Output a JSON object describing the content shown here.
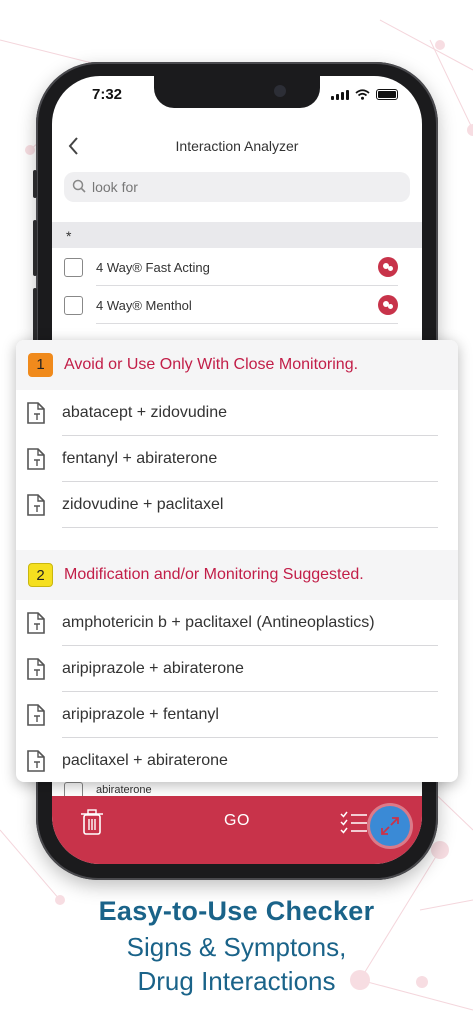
{
  "status_bar": {
    "time": "7:32"
  },
  "nav": {
    "title": "Interaction Analyzer"
  },
  "search": {
    "placeholder": "look for"
  },
  "drug_list": {
    "section_header": "*",
    "items": [
      {
        "label": "4 Way® Fast Acting",
        "checked": false
      },
      {
        "label": "4 Way® Menthol",
        "checked": false
      }
    ],
    "partial_item": {
      "label": "abiraterone"
    }
  },
  "bottom_bar": {
    "go_label": "GO",
    "color": "#c8334a"
  },
  "interactions": [
    {
      "level": "1",
      "badge_color": "#f08a1c",
      "title": "Avoid or Use Only With Close Monitoring.",
      "pairs": [
        "abatacept + zidovudine",
        "fentanyl + abiraterone",
        "zidovudine + paclitaxel"
      ]
    },
    {
      "level": "2",
      "badge_color": "#f5df1f",
      "title": "Modification and/or Monitoring Suggested.",
      "pairs": [
        "amphotericin b + paclitaxel (Antineoplastics)",
        "aripiprazole + abiraterone",
        "aripiprazole + fentanyl",
        "paclitaxel + abiraterone"
      ]
    }
  ],
  "tagline": {
    "line1": "Easy-to-Use Checker",
    "line2": "Signs & Symptons,",
    "line3": "Drug Interactions"
  },
  "colors": {
    "accent": "#c8334a",
    "severity_text": "#c21e48",
    "tagline": "#1a6389",
    "fab": "#3a8ad6"
  },
  "icons": [
    "back-chevron-icon",
    "search-icon",
    "wifi-icon",
    "battery-icon",
    "pill-icon",
    "document-icon",
    "trash-icon",
    "checklist-icon",
    "expand-icon"
  ]
}
